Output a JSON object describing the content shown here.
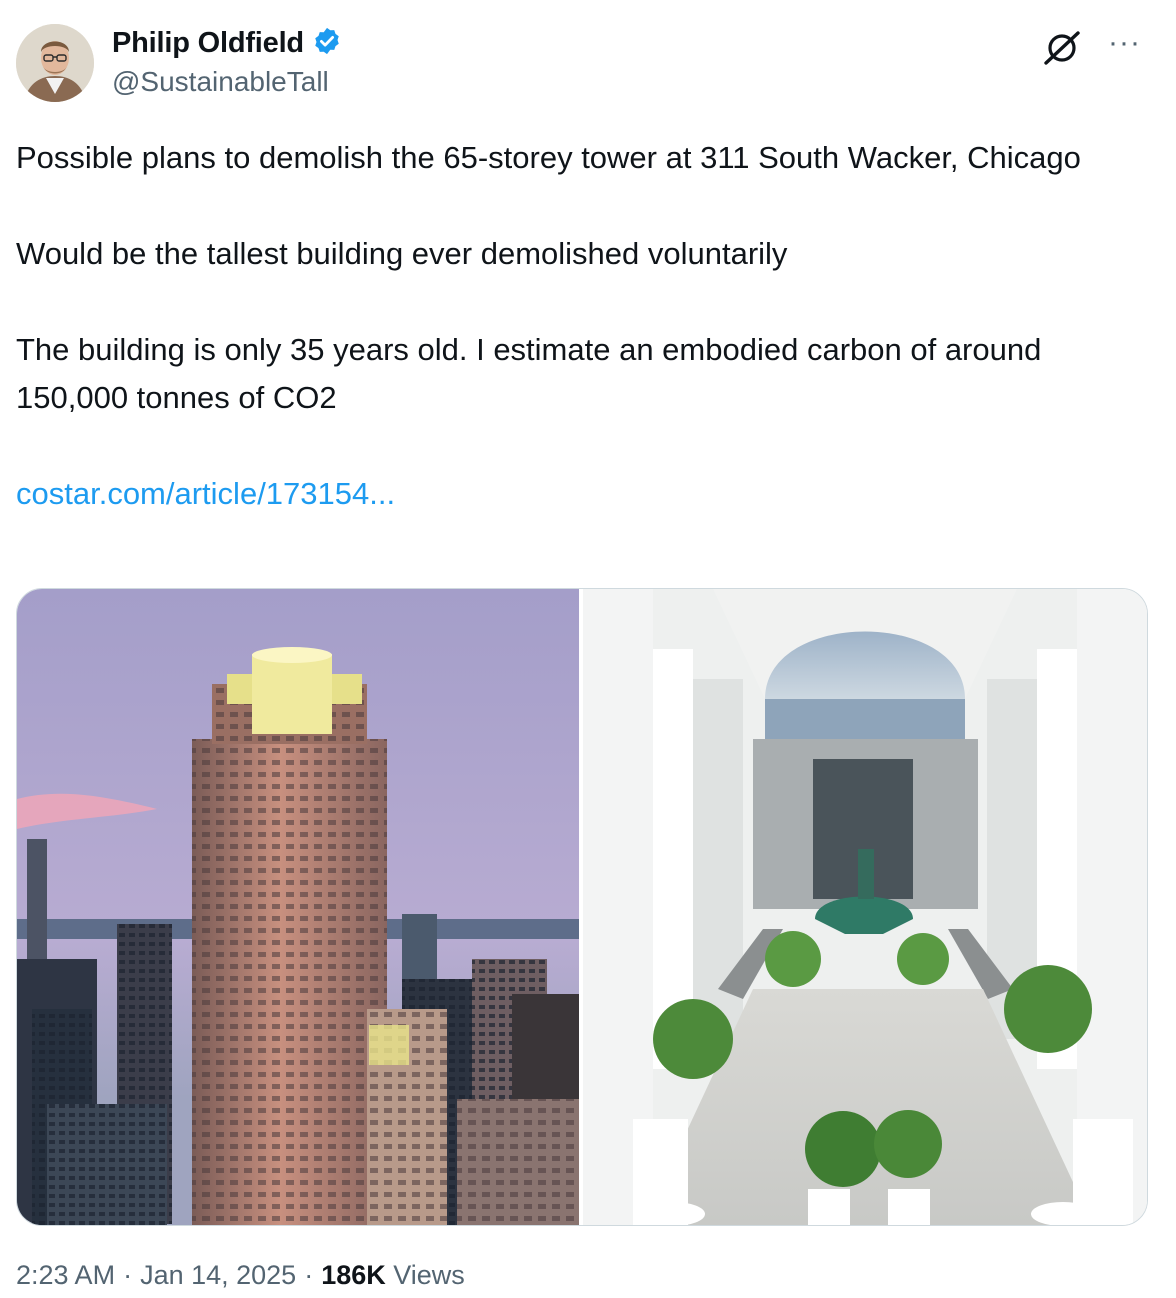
{
  "author": {
    "name": "Philip Oldfield",
    "handle": "@SustainableTall",
    "verified": true
  },
  "tweet": {
    "line1": "Possible plans to demolish the 65-storey tower at 311 South Wacker, Chicago",
    "line2": "Would be the tallest building ever demolished voluntarily",
    "line3": "The building is only 35 years old. I estimate an embodied carbon of around 150,000 tonnes of CO2",
    "link": "costar.com/article/173154..."
  },
  "meta": {
    "time": "2:23 AM",
    "sep1": "·",
    "date": "Jan 14, 2025",
    "sep2": "·",
    "views_count": "186K",
    "views_label": "Views"
  },
  "icons": {
    "verified": "verified-badge-icon",
    "grok": "grok-icon",
    "more": "more-icon"
  },
  "colors": {
    "link": "#1d9bf0",
    "verified": "#1d9bf0",
    "secondary_text": "#536471"
  }
}
